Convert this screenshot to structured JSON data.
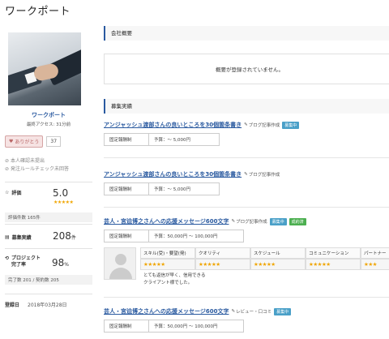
{
  "header": {
    "title": "ワークポート"
  },
  "profile": {
    "name": "ワークポート",
    "last_access": "最終アクセス: 31分前",
    "thanks_label": "ありがとう",
    "thanks_count": "37",
    "checks": [
      "本人確認未提出",
      "発注ルールチェック未回答"
    ],
    "rating_label": "評価",
    "rating_value": "5.0",
    "rating_stars": "★★★★★",
    "rating_count": "評価件数 165件",
    "jobs_label": "募集実績",
    "jobs_value": "208",
    "jobs_unit": "件",
    "completion_label": "プロジェクト\n完了率",
    "completion_value": "98",
    "completion_unit": "%",
    "completion_detail": "完了数 201 / 契約数 205",
    "registered_label": "登録日",
    "registered_value": "2018年03月28日"
  },
  "company_overview": {
    "heading": "会社概要",
    "text": "概要が登録されていません。"
  },
  "jobs_section": {
    "heading": "募集実績",
    "jobs": [
      {
        "title": "アンジャッシュ渡部さんの良いところを30個箇条書き",
        "category": "ブログ記事作成",
        "tags": [
          {
            "label": "募集中",
            "color": "#4aa0c8"
          }
        ],
        "pay_type": "固定報酬制",
        "budget": "予算：～ 5,000円"
      },
      {
        "title": "アンジャッシュ渡部さんの良いところを30個箇条書き",
        "category": "ブログ記事作成",
        "tags": [],
        "pay_type": "固定報酬制",
        "budget": "予算：～ 5,000円"
      },
      {
        "title": "芸人・宮迫博之さんへの応援メッセージ600文字",
        "category": "ブログ記事作成",
        "tags": [
          {
            "label": "募集中",
            "color": "#4aa0c8"
          },
          {
            "label": "成約済",
            "color": "#4caf50"
          }
        ],
        "pay_type": "固定報酬制",
        "budget": "予算：50,000円 ～ 100,000円",
        "review": {
          "headers": [
            "スキル(受)・要望(発)",
            "クオリティ",
            "スケジュール",
            "コミュニケーション",
            "パートナー"
          ],
          "stars": [
            "★★★★★",
            "★★★★★",
            "★★★★★",
            "★★★★★",
            "★★★"
          ],
          "comment_lines": [
            "とても返信が早く、信用できる",
            "クライアント様でした。"
          ]
        }
      },
      {
        "title": "芸人・宮迫博之さんへの応援メッセージ600文字",
        "category": "レビュー・口コミ",
        "tags": [
          {
            "label": "募集中",
            "color": "#4aa0c8"
          }
        ],
        "pay_type": "固定報酬制",
        "budget": "予算：50,000円 ～ 100,000円"
      }
    ]
  }
}
